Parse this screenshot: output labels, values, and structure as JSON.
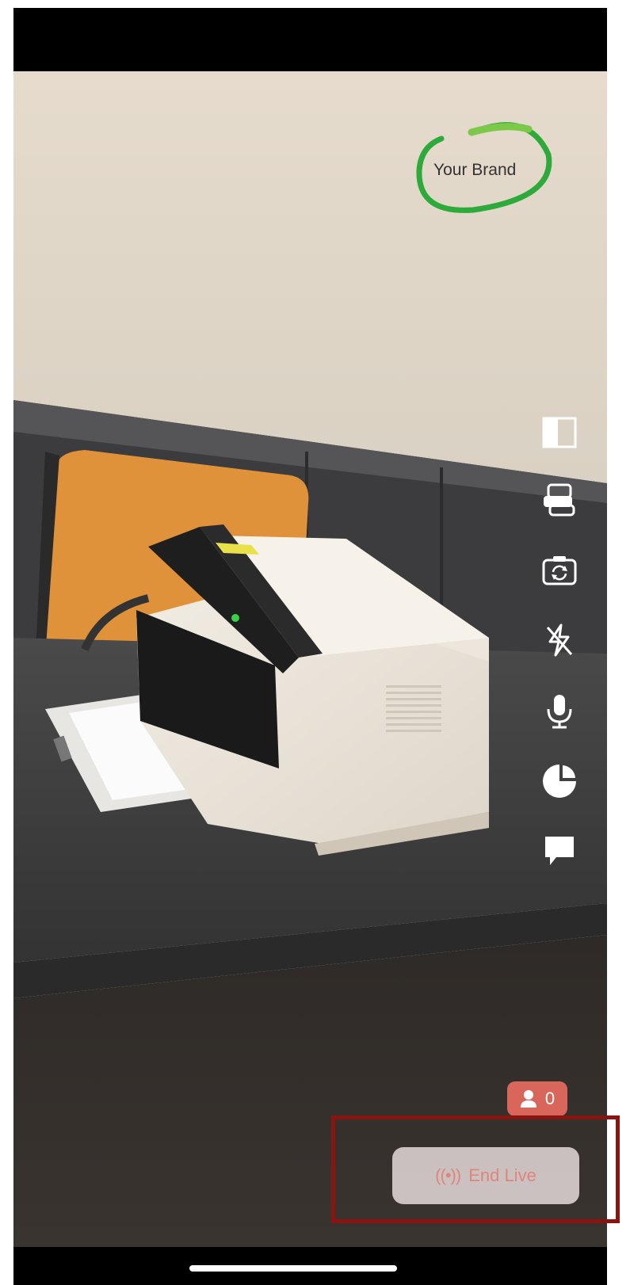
{
  "brand": {
    "text": "Your Brand",
    "ring_color": "#2eaa3a"
  },
  "controls": [
    {
      "name": "split-view-icon",
      "label": "split view"
    },
    {
      "name": "chat-bubbles-icon",
      "label": "conversations"
    },
    {
      "name": "switch-camera-icon",
      "label": "switch camera"
    },
    {
      "name": "flash-off-icon",
      "label": "flash off"
    },
    {
      "name": "microphone-icon",
      "label": "microphone"
    },
    {
      "name": "timer-pie-icon",
      "label": "timer"
    },
    {
      "name": "comment-icon",
      "label": "comment"
    }
  ],
  "viewers": {
    "count": "0",
    "icon": "person-icon"
  },
  "end_live": {
    "label": "End Live",
    "icon": "broadcast-icon",
    "icon_glyph": "((•))",
    "color": "#e0857c"
  },
  "colors": {
    "viewer_badge": "#d9665a",
    "highlight_box": "#8a1410"
  }
}
